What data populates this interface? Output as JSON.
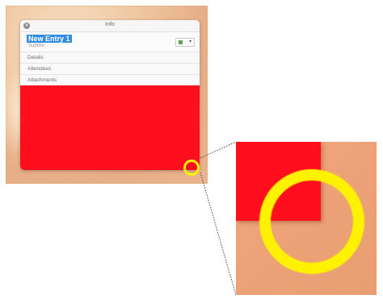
{
  "window": {
    "title": "Info",
    "close_glyph": "✕"
  },
  "entry": {
    "name": "New Entry 1",
    "subtitle": "Subtitle",
    "color": "#5aa84a",
    "chevron": "▾"
  },
  "sections": [
    {
      "label": "Details"
    },
    {
      "label": "Attendees"
    },
    {
      "label": "Attachments"
    }
  ],
  "colors": {
    "content_red": "#ff0f1d",
    "highlight_yellow": "#fff200",
    "selection_blue": "#2f8de4",
    "desktop_peach": "#efc7a1"
  },
  "icons": {
    "close": "close-icon",
    "color_swatch": "color-swatch-icon",
    "dropdown": "chevron-down-icon"
  }
}
